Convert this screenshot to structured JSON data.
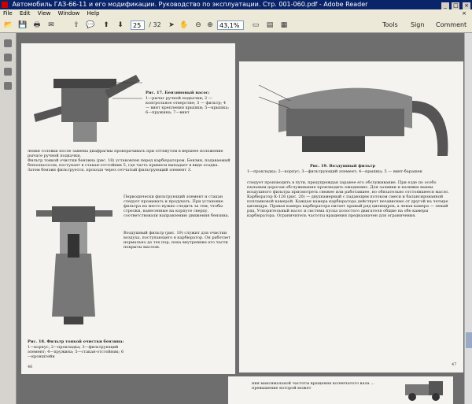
{
  "window": {
    "title": "Автомобиль ГАЗ-66-11 и его модификации. Руководство по эксплуатации. Стр. 001-060.pdf - Adobe Reader",
    "controls": [
      "_",
      "□",
      "×"
    ]
  },
  "menu": {
    "items": [
      "File",
      "Edit",
      "View",
      "Window",
      "Help"
    ],
    "close": "×"
  },
  "toolbar": {
    "page_current": "25",
    "page_total": "/ 32",
    "zoom": "43,1%",
    "tools": "Tools",
    "sign": "Sign",
    "comment": "Comment"
  },
  "left_page": {
    "fig17_caption": "Рис. 17. Бензиновый насос:",
    "fig17_legend": "1—рычаг ручной подкачки; 2 — контрольное отверстие; 3 — фильтр; 4 — винт крепления крышки; 5—крышка; 6—пружина; 7—винт",
    "para1": "ления головки после замены диафрагмы проворачивать при оттянутом в верхнее положение рычаге ручной подкачки.",
    "para2": "Фильтр тонкой очистки бензина (рис. 18) установлен перед карбюратором. Бензин, подаваемый бензонасосом, поступает в стакан-отстойник 5, где часть примеси выпадает в виде осадка. Затем бензин фильтруется, проходя через сетчатый фильтрующий элемент 3.",
    "para3": "Периодически фильтрующий элемент и стакан следует промывать и продувать. При установке фильтра на место нужно следить за тем, чтобы стрелки, нанесенные на корпусе сверху, соответствовали направлению движения бензина.",
    "para4": "Воздушный фильтр (рис. 19) служит для очистки воздуха, поступающего в карбюратор. Он работает нормально до тех пор, пока внутренние его части покрыты маслом.",
    "fig18_caption": "Рис. 18. Фильтр тонкой очистки бензина:",
    "fig18_legend": "1—корпус; 2—прокладка; 3—фильтрующий элемент; 4—пружина; 5—стакан-отстойник; 6—кронштейн",
    "page_num": "46"
  },
  "right_page": {
    "fig19_caption": "Рис. 19. Воздушный фильтр",
    "fig19_legend": "1—прокладка; 2—корпус; 3—фильтрующий элемент; 4—крышка; 5 — винт-барашек",
    "body": "следует производить в пути, предупреждая заранее его обслуживание. При езде по особо пыльным дорогам обслуживание производить ежедневно. Для заливки и наливки ванны воздушного фильтра присмотреть свежее или работавшее, но обязательно отстоявшееся масло. Карбюратор К-126 (рис. 20) — двухкамерный с падающим потоком смеси и балансированной поплавковой камерой. Каждая камера карбюратора действует независимо от другой на четыре цилиндра. Правая камера карбюратора питает правый ряд цилиндров, а левая камера — левый ряд. Ускорительный насос и система пуска холостого двигателя общие на обе камеры карбюратора. Ограничитель частоты вращения предназначен для ограничения.",
    "page_num": "47"
  },
  "bottom_page": {
    "text": "ния максимальной частоты вращения коленчатого вала ... превышение которой может"
  },
  "colors": {
    "titlebar": "#0a246a",
    "page_bg": "#f4f3ef",
    "workspace": "#6e6e6e"
  }
}
